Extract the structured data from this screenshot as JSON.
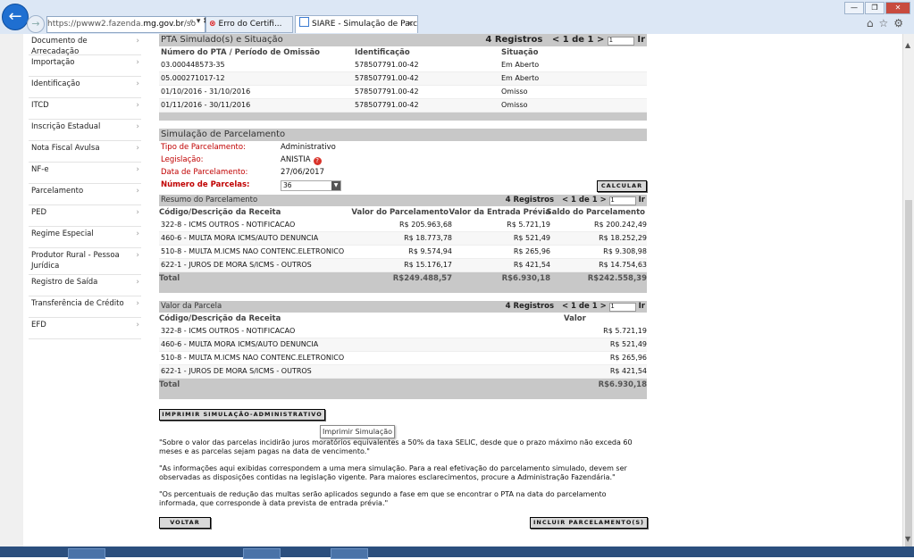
{
  "browser": {
    "address_prefix": "https://pwww2.fazenda.",
    "address_domain": "mg.gov.br",
    "address_suffix": "/so",
    "address_icons": "⌕ ▾ ✖",
    "tab_error_label": "Erro do Certifi...",
    "tab_active_label": "SIARE - Simulação de Parce...",
    "tab_close": "×"
  },
  "sidebar": {
    "items": [
      {
        "label": "Documento de Arrecadação"
      },
      {
        "label": "Importação"
      },
      {
        "label": "Identificação"
      },
      {
        "label": "ITCD"
      },
      {
        "label": "Inscrição Estadual"
      },
      {
        "label": "Nota Fiscal Avulsa"
      },
      {
        "label": "NF-e"
      },
      {
        "label": "Parcelamento"
      },
      {
        "label": "PED"
      },
      {
        "label": "Regime Especial"
      },
      {
        "label": "Produtor Rural - Pessoa Jurídica"
      },
      {
        "label": "Registro de Saída"
      },
      {
        "label": "Transferência de Crédito"
      },
      {
        "label": "EFD"
      }
    ],
    "chevron": "›"
  },
  "pta": {
    "title": "PTA Simulado(s) e Situação",
    "count": "4 Registros",
    "pager": "< 1 de 1 >",
    "page_value": "1",
    "go": "Ir",
    "headers": [
      "Número do PTA / Período de Omissão",
      "Identificação",
      "Situação"
    ],
    "rows": [
      [
        "03.000448573-35",
        "578507791.00-42",
        "Em Aberto"
      ],
      [
        "05.000271017-12",
        "578507791.00-42",
        "Em Aberto"
      ],
      [
        "01/10/2016 - 31/10/2016",
        "578507791.00-42",
        "Omisso"
      ],
      [
        "01/11/2016 - 30/11/2016",
        "578507791.00-42",
        "Omisso"
      ]
    ]
  },
  "simulacao": {
    "title": "Simulação de Parcelamento",
    "tipo_label": "Tipo de Parcelamento:",
    "tipo_value": "Administrativo",
    "legislacao_label": "Legislação:",
    "legislacao_value": "ANISTIA",
    "data_label": "Data de Parcelamento:",
    "data_value": "27/06/2017",
    "parcelas_label": "Número de Parcelas:",
    "parcelas_value": "36",
    "calcular": "CALCULAR"
  },
  "resumo": {
    "title": "Resumo do Parcelamento",
    "count": "4 Registros",
    "pager": "< 1 de 1 >",
    "page_value": "1",
    "go": "Ir",
    "headers": [
      "Código/Descrição da Receita",
      "Valor do Parcelamento",
      "Valor da Entrada Prévia",
      "Saldo do Parcelamento"
    ],
    "rows": [
      [
        "322-8 - ICMS OUTROS - NOTIFICACAO",
        "R$ 205.963,68",
        "R$ 5.721,19",
        "R$ 200.242,49"
      ],
      [
        "460-6 - MULTA MORA ICMS/AUTO DENUNCIA",
        "R$ 18.773,78",
        "R$ 521,49",
        "R$ 18.252,29"
      ],
      [
        "510-8 - MULTA M.ICMS NAO CONTENC.ELETRONICO",
        "R$ 9.574,94",
        "R$ 265,96",
        "R$ 9.308,98"
      ],
      [
        "622-1 - JUROS DE MORA S/ICMS - OUTROS",
        "R$ 15.176,17",
        "R$ 421,54",
        "R$ 14.754,63"
      ]
    ],
    "total_label": "Total",
    "total_values": [
      "R$249.488,57",
      "R$6.930,18",
      "R$242.558,39"
    ]
  },
  "parcela": {
    "title": "Valor da Parcela",
    "count": "4 Registros",
    "pager": "< 1 de 1 >",
    "page_value": "1",
    "go": "Ir",
    "headers": [
      "Código/Descrição da Receita",
      "Valor"
    ],
    "rows": [
      [
        "322-8 - ICMS OUTROS - NOTIFICACAO",
        "R$ 5.721,19"
      ],
      [
        "460-6 - MULTA MORA ICMS/AUTO DENUNCIA",
        "R$ 521,49"
      ],
      [
        "510-8 - MULTA M.ICMS NAO CONTENC.ELETRONICO",
        "R$ 265,96"
      ],
      [
        "622-1 - JUROS DE MORA S/ICMS - OUTROS",
        "R$ 421,54"
      ]
    ],
    "total_label": "Total",
    "total_value": "R$6.930,18"
  },
  "actions": {
    "imprimir": "IMPRIMIR SIMULAÇÃO-ADMINISTRATIVO",
    "tooltip": "Imprimir Simulação",
    "voltar": "VOLTAR",
    "incluir": "INCLUIR PARCELAMENTO(S)"
  },
  "notes": [
    "\"Sobre o valor das parcelas incidirão juros moratórios equivalentes a 50% da taxa SELIC, desde que o prazo máximo não exceda 60 meses e as parcelas sejam pagas na data de vencimento.\"",
    "\"As informações aqui exibidas correspondem a uma mera simulação. Para a real efetivação do parcelamento simulado, devem ser observadas as disposições contidas na legislação vigente. Para maiores esclarecimentos, procure a Administração Fazendária.\"",
    "\"Os percentuais de redução das multas serão aplicados segundo a fase em que se encontrar o PTA na data do parcelamento informada, que corresponde à data prevista de entrada prévia.\""
  ],
  "colors": {
    "label_red": "#c00000",
    "header_gray": "#c8c8c8"
  }
}
